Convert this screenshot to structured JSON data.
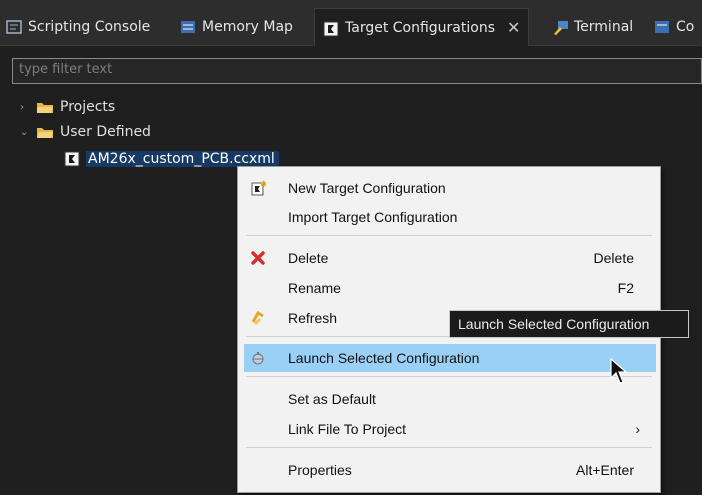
{
  "tabs": [
    {
      "label": "Scripting Console",
      "icon": "console-icon"
    },
    {
      "label": "Memory Map",
      "icon": "memory-map-icon"
    },
    {
      "label": "Target Configurations",
      "icon": "target-config-icon",
      "active": true
    },
    {
      "label": "Terminal",
      "icon": "terminal-icon"
    },
    {
      "label": "Co",
      "icon": "console-icon"
    }
  ],
  "filter": {
    "placeholder": "type filter text"
  },
  "tree": {
    "projects": "Projects",
    "user_defined": "User Defined",
    "file": "AM26x_custom_PCB.ccxml"
  },
  "menu": {
    "new_target": "New Target Configuration",
    "import_target": "Import Target Configuration",
    "delete": "Delete",
    "delete_accel": "Delete",
    "rename": "Rename",
    "rename_accel": "F2",
    "refresh": "Refresh",
    "launch": "Launch Selected Configuration",
    "set_default": "Set as Default",
    "link_file": "Link File To Project",
    "link_arrow": "›",
    "properties": "Properties",
    "properties_accel": "Alt+Enter"
  },
  "tooltip": "Launch Selected Configuration",
  "colors": {
    "background": "#1f1f1f",
    "menu_background": "#f2f2f2",
    "menu_highlight": "#9ad0f5",
    "selection": "#163a63"
  }
}
